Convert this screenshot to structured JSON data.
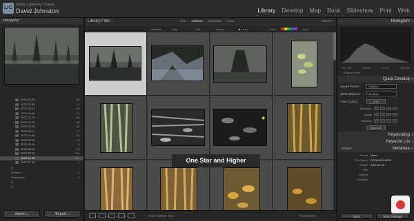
{
  "app": {
    "logo": "LrC",
    "name": "Adobe Lightroom Classic",
    "user": "David Johnston"
  },
  "modules": [
    "Library",
    "Develop",
    "Map",
    "Book",
    "Slideshow",
    "Print",
    "Web"
  ],
  "active_module": "Library",
  "navigator": {
    "title": "Navigator",
    "zoom": "FIT  ›  100%   200%"
  },
  "folders": [
    {
      "name": "2022-03-03",
      "count": "84"
    },
    {
      "name": "2022-03-06",
      "count": "79"
    },
    {
      "name": "2022-03-07",
      "count": "56"
    },
    {
      "name": "2022-04-04",
      "count": "72"
    },
    {
      "name": "2022-04-13",
      "count": "66"
    },
    {
      "name": "2022-04-20",
      "count": "62"
    },
    {
      "name": "2022-04-24",
      "count": "84"
    },
    {
      "name": "2022-04-27",
      "count": "77"
    },
    {
      "name": "2022-04-28",
      "count": "64"
    },
    {
      "name": "2022-05-13",
      "count": "78"
    },
    {
      "name": "2022-05-14",
      "count": "6"
    },
    {
      "name": "2022-05-18",
      "count": "55"
    },
    {
      "name": "2022-10-29",
      "count": "394"
    },
    {
      "name": "2022-11-06",
      "count": "303",
      "selected": true
    },
    {
      "name": "2022-11-16",
      "count": "1"
    }
  ],
  "drives": [
    {
      "name": "D:",
      "count": ""
    },
    {
      "name": "Desktop",
      "count": "1"
    },
    {
      "name": "Downloads",
      "count": "1"
    },
    {
      "name": "E:",
      "count": ""
    },
    {
      "name": "F:",
      "count": ""
    }
  ],
  "left_buttons": {
    "import": "Import...",
    "export": "Export..."
  },
  "library_filter": {
    "title": "Library Filter :",
    "options": [
      "Text",
      "Attribute",
      "Metadata",
      "None"
    ],
    "active": "Attribute",
    "preset": "Rated ▾"
  },
  "attribute_bar": {
    "attribute": "Attribute",
    "flag": "Flag",
    "edit": "Edit",
    "rating": "Rating",
    "color": "Color",
    "kind": "Kind"
  },
  "toast": "One Star and Higher",
  "toolbar": {
    "sort_label": "Sort:",
    "sort_value": "Capture Time",
    "thumbnails": "Thumbnails"
  },
  "right_panel": {
    "histogram": "Histogram",
    "hist_stats": [
      "ISO 160",
      "55 mm",
      "f / 4.0",
      "1/25 sec"
    ],
    "original_photo": "Original Photo",
    "quick_develop": "Quick Develop",
    "saved_preset_label": "Saved Preset",
    "saved_preset": "Custom",
    "white_balance_label": "White Balance",
    "white_balance": "As Shot",
    "tone_control_label": "Tone Control",
    "tone_control": "Auto",
    "adjustments": [
      "Exposure",
      "Clarity",
      "Vibrance"
    ],
    "reset_all": "Reset All",
    "keywording": "Keywording",
    "keyword_list": "Keyword List",
    "metadata": "Metadata",
    "metadata_preset": "Default",
    "metadata_fields": [
      {
        "label": "Preset",
        "value": "None"
      },
      {
        "label": "File Name",
        "value": "DSC04493.ARW"
      },
      {
        "label": "Folder",
        "value": "2022-11-06"
      },
      {
        "label": "Title",
        "value": ""
      },
      {
        "label": "Caption",
        "value": ""
      },
      {
        "label": "Copyright",
        "value": ""
      }
    ],
    "sync": "Sync",
    "sync_settings": "Sync Settings"
  },
  "colors": {
    "accent": "#e6e6e6",
    "star": "#d8c44a",
    "record": "#d53a3a"
  }
}
